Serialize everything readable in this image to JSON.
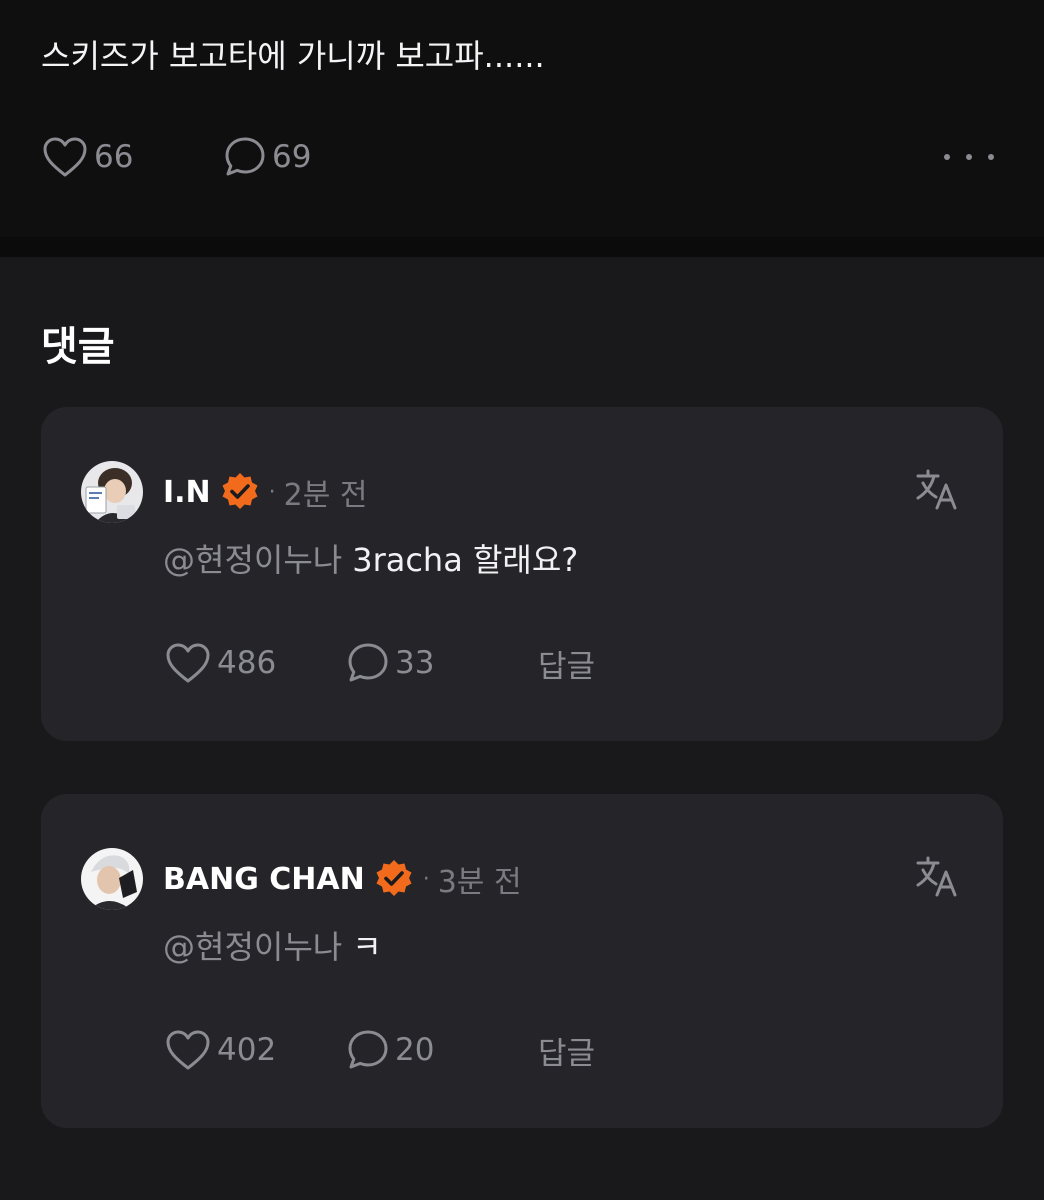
{
  "post": {
    "text": "스키즈가 보고타에 가니까 보고파......",
    "likes": "66",
    "comments": "69",
    "more_icon": "more-horizontal-icon"
  },
  "section_title": "댓글",
  "comments": [
    {
      "username": "I.N",
      "verified_color": "#f26b1d",
      "dot": "·",
      "time": "2분 전",
      "mention": "@현정이누나",
      "text": "3racha 할래요?",
      "likes": "486",
      "replies": "33",
      "reply_label": "답글"
    },
    {
      "username": "BANG CHAN",
      "verified_color": "#f26b1d",
      "dot": "·",
      "time": "3분 전",
      "mention": "@현정이누나",
      "text": "ㅋ",
      "likes": "402",
      "replies": "20",
      "reply_label": "답글"
    }
  ],
  "colors": {
    "background": "#19191c",
    "post_background": "#0f0f10",
    "card_background": "#252529",
    "muted_text": "#8b8b92",
    "verified_badge": "#f26b1d"
  }
}
